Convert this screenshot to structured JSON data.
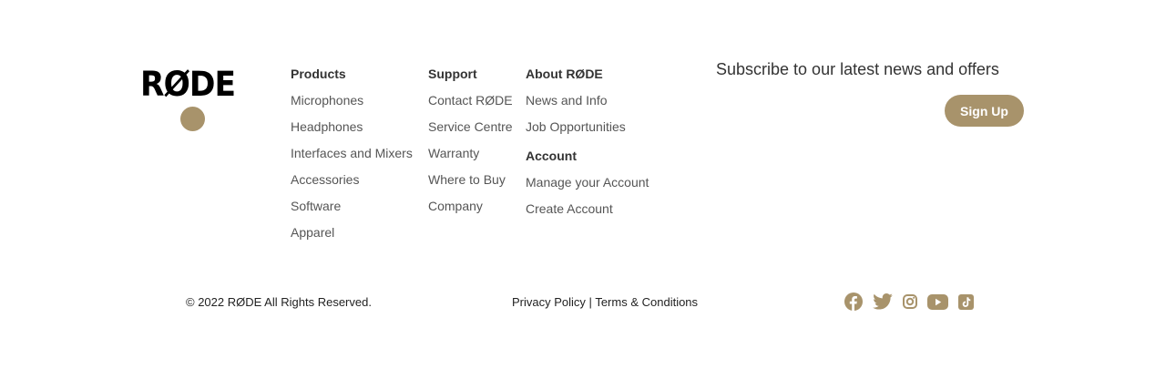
{
  "brand": {
    "logo_text": "RØDE",
    "accent_color": "#a8936b"
  },
  "columns": {
    "products": {
      "heading": "Products",
      "items": [
        "Microphones",
        "Headphones",
        "Interfaces and Mixers",
        "Accessories",
        "Software",
        "Apparel"
      ]
    },
    "support": {
      "heading": "Support",
      "items": [
        "Contact RØDE",
        "Service Centre",
        "Warranty",
        "Where to Buy",
        "Company"
      ]
    },
    "about": {
      "heading": "About RØDE",
      "items": [
        "News and Info",
        "Job Opportunities"
      ]
    },
    "account": {
      "heading": "Account",
      "items": [
        "Manage your Account",
        "Create Account"
      ]
    }
  },
  "subscribe": {
    "title": "Subscribe to our latest news and offers",
    "button_label": "Sign Up"
  },
  "footer": {
    "copyright": "© 2022 RØDE All Rights Reserved.",
    "privacy": "Privacy Policy",
    "separator": "|",
    "terms": "Terms & Conditions"
  },
  "socials": [
    "facebook-icon",
    "twitter-icon",
    "instagram-icon",
    "youtube-icon",
    "tiktok-icon"
  ]
}
